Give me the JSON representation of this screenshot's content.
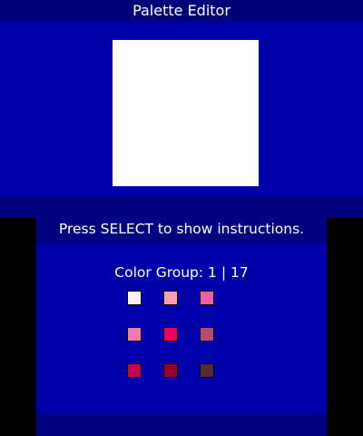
{
  "header": {
    "title": "Palette Editor"
  },
  "instructions": {
    "text": "Press SELECT to show instructions."
  },
  "color_group": {
    "label": "Color Group: 1 | 17"
  },
  "swatches": [
    {
      "color": "#fff0ff"
    },
    {
      "color": "#f8a0b0"
    },
    {
      "color": "#f060a0"
    },
    {
      "color": "#f878b0"
    },
    {
      "color": "#f00060"
    },
    {
      "color": "#b84878"
    },
    {
      "color": "#c80050"
    },
    {
      "color": "#980030"
    },
    {
      "color": "#582838"
    }
  ],
  "colors": {
    "screen_bg": "#0000a8",
    "bar_bg": "#000080",
    "title_bar_bg": "#000078",
    "letterbox": "#000000",
    "canvas": "#ffffff"
  }
}
